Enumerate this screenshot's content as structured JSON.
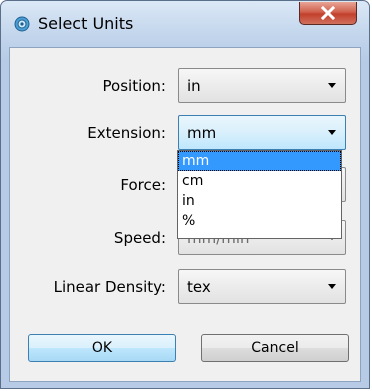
{
  "window": {
    "title": "Select Units",
    "colors": {
      "frame": "#c2d5ec",
      "close_button": "#c2402c",
      "client": "#f0f0f0",
      "selection": "#3399ff"
    }
  },
  "form": {
    "position": {
      "label": "Position:",
      "value": "in"
    },
    "extension": {
      "label": "Extension:",
      "value": "mm"
    },
    "force": {
      "label": "Force:"
    },
    "speed": {
      "label": "Speed:",
      "value": "mm/min"
    },
    "linear_density": {
      "label": "Linear Density:",
      "value": "tex"
    }
  },
  "dropdown": {
    "options": [
      "mm",
      "cm",
      "in",
      "%"
    ],
    "selected": "mm"
  },
  "buttons": {
    "ok": "OK",
    "cancel": "Cancel"
  },
  "icons": {
    "app": "app-globe-icon",
    "close": "close-icon",
    "combo_arrow": "chevron-down-icon"
  }
}
